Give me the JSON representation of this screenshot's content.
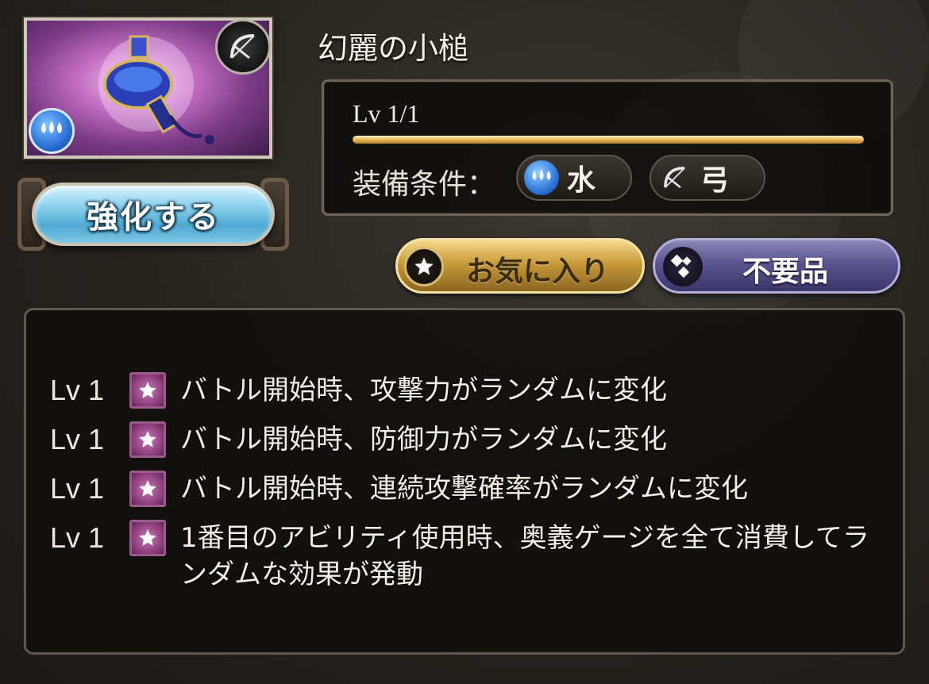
{
  "weapon": {
    "name": "幻麗の小槌",
    "level_text": "Lv 1/1",
    "level_progress": 1.0
  },
  "upgrade_button": {
    "label": "強化する"
  },
  "equip": {
    "label": "装備条件：",
    "element": "水",
    "weapon_type": "弓"
  },
  "actions": {
    "favorite_label": "お気に入り",
    "junk_label": "不要品"
  },
  "skills": [
    {
      "level": "Lv 1",
      "text": "バトル開始時、攻撃力がランダムに変化"
    },
    {
      "level": "Lv 1",
      "text": "バトル開始時、防御力がランダムに変化"
    },
    {
      "level": "Lv 1",
      "text": "バトル開始時、連続攻撃確率がランダムに変化"
    },
    {
      "level": "Lv 1",
      "text": "1番目のアビリティ使用時、奥義ゲージを全て消費してランダムな効果が発動"
    }
  ],
  "icons": {
    "weapon_type": "bow-icon",
    "element": "water-icon",
    "favorite": "star-icon",
    "junk": "junk-icon",
    "skill": "star-icon"
  },
  "colors": {
    "upgrade_button": "#8fd2ee",
    "favorite_button": "#c89a3a",
    "junk_button": "#5a5590",
    "level_bar": "#e8b957",
    "skill_icon": "#8a3c7a"
  }
}
